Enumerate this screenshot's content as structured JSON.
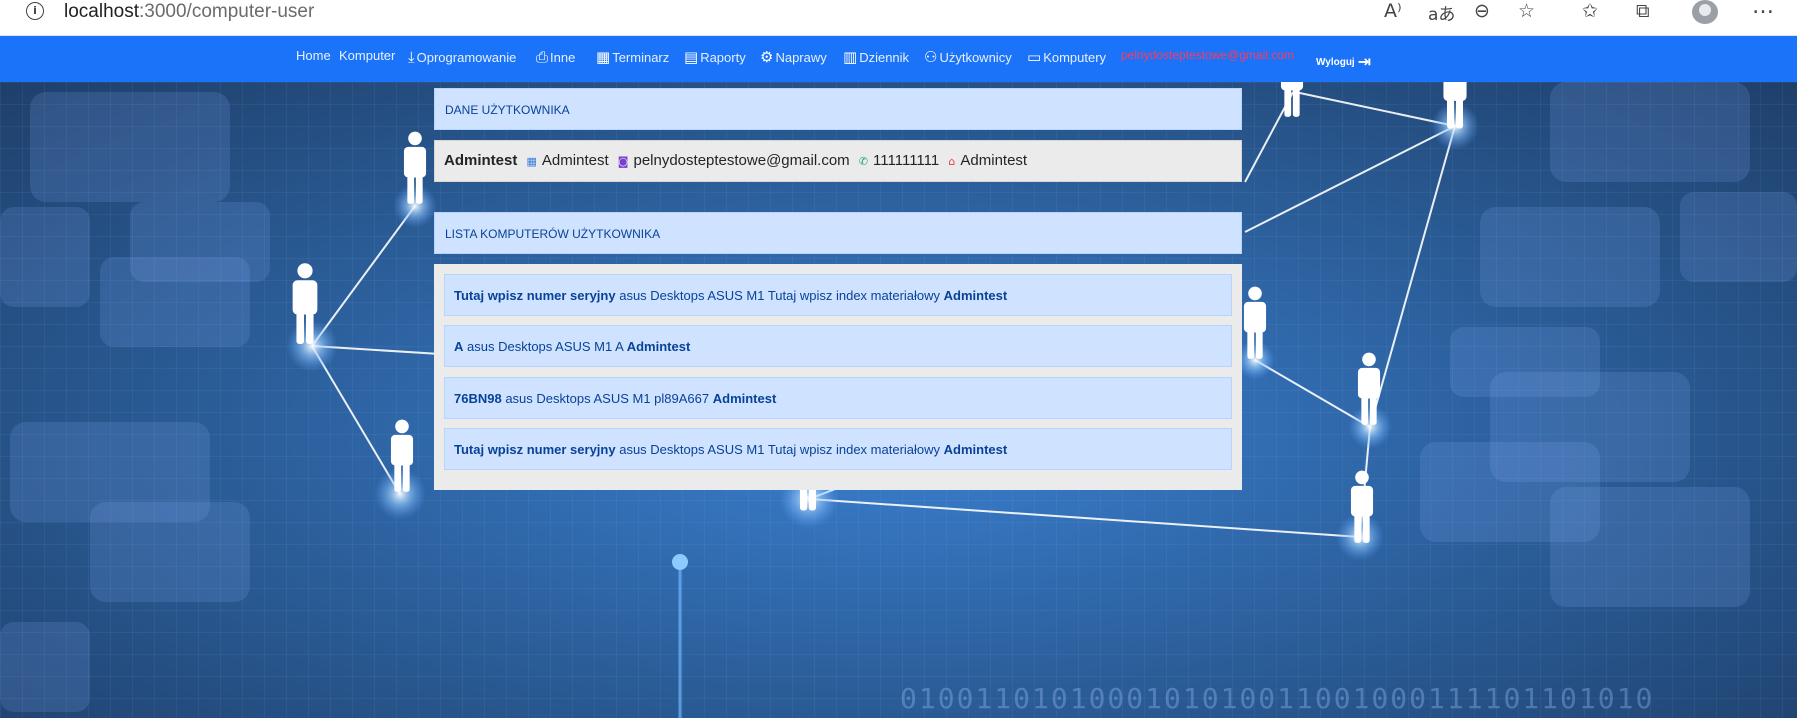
{
  "browser": {
    "url_host": "localhost",
    "url_rest": ":3000/computer-user",
    "icons": [
      "info-icon",
      "read-aloud-icon",
      "translate-icon",
      "zoom-out-icon",
      "favorite-add-icon",
      "favorites-icon",
      "collections-icon",
      "profile-icon",
      "more-icon"
    ]
  },
  "nav": {
    "items": [
      {
        "label": "Home",
        "icon": ""
      },
      {
        "label": "Komputer",
        "icon": ""
      },
      {
        "label": "Oprogramowanie",
        "icon": "download-icon"
      },
      {
        "label": "Inne",
        "icon": "printer-icon"
      },
      {
        "label": "Terminarz",
        "icon": "calendar-icon"
      },
      {
        "label": "Raporty",
        "icon": "clipboard-icon"
      },
      {
        "label": "Naprawy",
        "icon": "gear-icon"
      },
      {
        "label": "Dziennik",
        "icon": "journal-icon"
      },
      {
        "label": "Użytkownicy",
        "icon": "users-icon"
      },
      {
        "label": "Komputery",
        "icon": "laptop-icon"
      }
    ],
    "email": "pelnydosteptestowe@gmail.com",
    "logout": "Wyloguj"
  },
  "user_panel": {
    "header": "DANE UŻYTKOWNIKA",
    "name_bold": "Admintest",
    "building": "Admintest",
    "email": "pelnydosteptestowe@gmail.com",
    "phone": "111111111",
    "home": "Admintest"
  },
  "computers_panel": {
    "header": "LISTA KOMPUTERÓW UŻYTKOWNIKA",
    "items": [
      {
        "serial": "Tutaj wpisz numer seryjny",
        "info": "asus Desktops ASUS M1 Tutaj wpisz index materiałowy",
        "owner": "Admintest"
      },
      {
        "serial": "A",
        "info": "asus Desktops ASUS M1 A",
        "owner": "Admintest"
      },
      {
        "serial": "76BN98",
        "info": "asus Desktops ASUS M1 pl89A667",
        "owner": "Admintest"
      },
      {
        "serial": "Tutaj wpisz numer seryjny",
        "info": "asus Desktops ASUS M1 Tutaj wpisz index materiałowy",
        "owner": "Admintest"
      }
    ]
  },
  "background_binary": "0100110101000101010011001000111101101010"
}
